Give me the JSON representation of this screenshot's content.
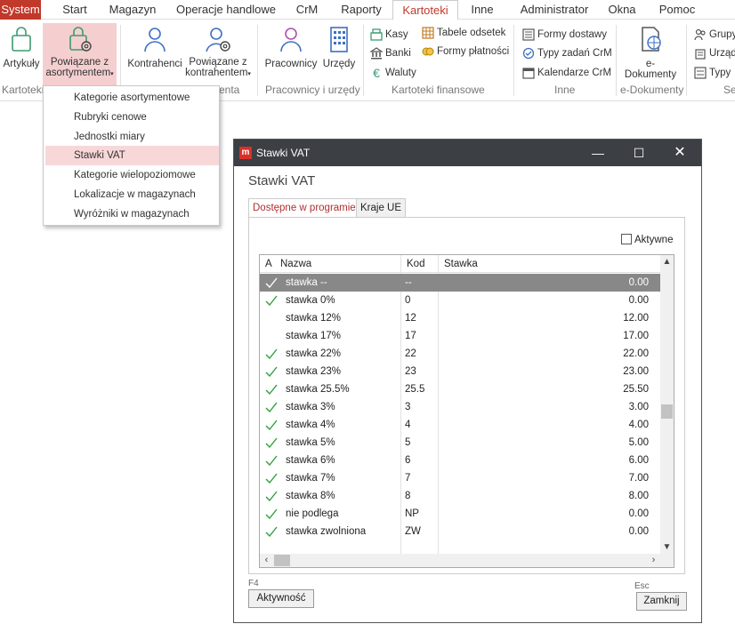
{
  "menu": {
    "items": [
      {
        "label": "System"
      },
      {
        "label": "Start"
      },
      {
        "label": "Magazyn"
      },
      {
        "label": "Operacje handlowe"
      },
      {
        "label": "CrM"
      },
      {
        "label": "Raporty"
      },
      {
        "label": "Kartoteki"
      },
      {
        "label": "Inne"
      },
      {
        "label": "Administrator"
      },
      {
        "label": "Okna"
      },
      {
        "label": "Pomoc"
      }
    ],
    "active": "Kartoteki"
  },
  "ribbon": {
    "artykuly": "Artykuły",
    "powiazane_asort_1": "Powiązane z",
    "powiazane_asort_2": "asortymentem",
    "kontrahenci": "Kontrahenci",
    "powiazane_kontr_1": "Powiązane z",
    "powiazane_kontr_2": "kontrahentem",
    "pracownicy": "Pracownicy",
    "urzedy": "Urzędy",
    "kasy": "Kasy",
    "banki": "Banki",
    "waluty": "Waluty",
    "tabele_odsetek": "Tabele odsetek",
    "formy_platnosci": "Formy płatności",
    "formy_dostawy": "Formy dostawy",
    "typy_zadan": "Typy zadań CrM",
    "kalendarze": "Kalendarze CrM",
    "e_dokumenty": "e-Dokumenty",
    "grupy": "Grupy",
    "urzad": "Urząd",
    "typy": "Typy",
    "groups": {
      "kartoteki": "Kartoteki",
      "kontrahenci_tail": "enta",
      "pracownicy": "Pracownicy i urzędy",
      "finansowe": "Kartoteki finansowe",
      "inne": "Inne",
      "edok": "e-Dokumenty",
      "last": "Se"
    }
  },
  "dropdown": {
    "items": [
      "Kategorie asortymentowe",
      "Rubryki cenowe",
      "Jednostki miary",
      "Stawki VAT",
      "Kategorie wielopoziomowe",
      "Lokalizacje w magazynach",
      "Wyróżniki w magazynach"
    ],
    "highlighted": "Stawki VAT"
  },
  "dialog": {
    "window_title": "Stawki VAT",
    "heading": "Stawki VAT",
    "tabs": [
      "Dostępne w programie",
      "Kraje UE"
    ],
    "active_tab": "Dostępne w programie",
    "aktywne_label": "Aktywne",
    "columns": {
      "a": "A",
      "nazwa": "Nazwa",
      "kod": "Kod",
      "stawka": "Stawka"
    },
    "rows": [
      {
        "active": true,
        "nazwa": "stawka --",
        "kod": "--",
        "stawka": "0.00",
        "selected": true
      },
      {
        "active": true,
        "nazwa": "stawka 0%",
        "kod": "0",
        "stawka": "0.00"
      },
      {
        "active": false,
        "nazwa": "stawka 12%",
        "kod": "12",
        "stawka": "12.00"
      },
      {
        "active": false,
        "nazwa": "stawka 17%",
        "kod": "17",
        "stawka": "17.00"
      },
      {
        "active": true,
        "nazwa": "stawka 22%",
        "kod": "22",
        "stawka": "22.00"
      },
      {
        "active": true,
        "nazwa": "stawka 23%",
        "kod": "23",
        "stawka": "23.00"
      },
      {
        "active": true,
        "nazwa": "stawka 25.5%",
        "kod": "25.5",
        "stawka": "25.50"
      },
      {
        "active": true,
        "nazwa": "stawka 3%",
        "kod": "3",
        "stawka": "3.00"
      },
      {
        "active": true,
        "nazwa": "stawka 4%",
        "kod": "4",
        "stawka": "4.00"
      },
      {
        "active": true,
        "nazwa": "stawka 5%",
        "kod": "5",
        "stawka": "5.00"
      },
      {
        "active": true,
        "nazwa": "stawka 6%",
        "kod": "6",
        "stawka": "6.00"
      },
      {
        "active": true,
        "nazwa": "stawka 7%",
        "kod": "7",
        "stawka": "7.00"
      },
      {
        "active": true,
        "nazwa": "stawka 8%",
        "kod": "8",
        "stawka": "8.00"
      },
      {
        "active": true,
        "nazwa": "nie podlega",
        "kod": "NP",
        "stawka": "0.00"
      },
      {
        "active": true,
        "nazwa": "stawka zwolniona",
        "kod": "ZW",
        "stawka": "0.00"
      }
    ],
    "aktywnosc_key": "F4",
    "aktywnosc_label": "Aktywność",
    "zamknij_key": "Esc",
    "zamknij_label": "Zamknij"
  },
  "colors": {
    "accent": "#c0392b",
    "titlebar": "#3c3f44",
    "check": "#2e9e3e",
    "highlight": "#f8d7d8"
  }
}
